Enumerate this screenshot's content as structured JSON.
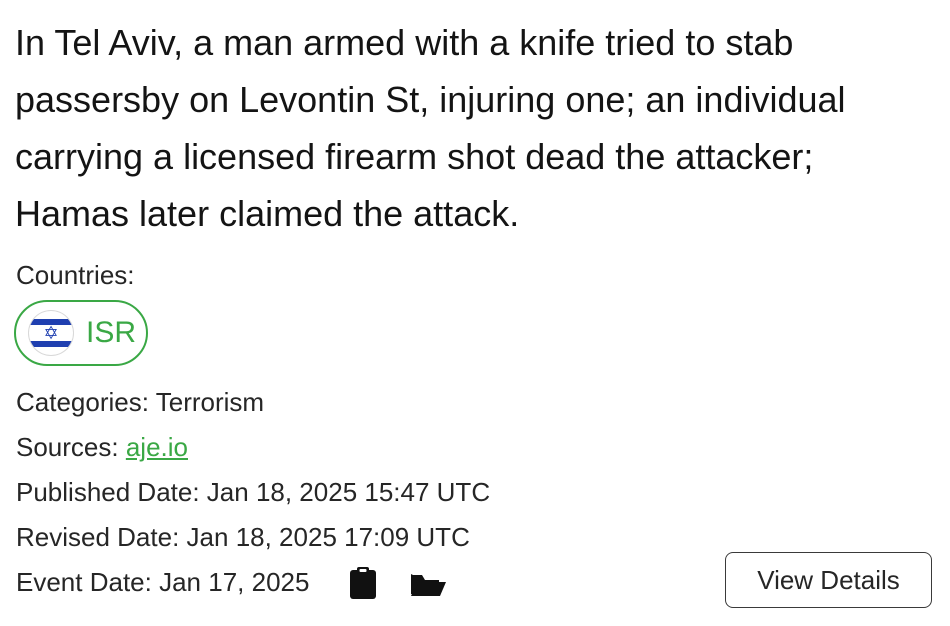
{
  "event": {
    "headline": "In Tel Aviv, a man armed with a knife tried to stab passersby on Levontin St, injuring one; an individual carrying a licensed firearm shot dead the attacker; Hamas later claimed the attack.",
    "countries_label": "Countries:",
    "countries": [
      {
        "code": "ISR",
        "flag_icon": "israel-flag-icon",
        "color": "#3aa845"
      }
    ],
    "categories_label": "Categories:",
    "categories_value": "Terrorism",
    "sources_label": "Sources:",
    "sources_link": "aje.io",
    "published_label": "Published Date:",
    "published_value": "Jan 18, 2025 15:47 UTC",
    "revised_label": "Revised Date:",
    "revised_value": "Jan 18, 2025 17:09 UTC",
    "event_date_label": "Event Date:",
    "event_date_value": "Jan 17, 2025",
    "icons": [
      "clipboard-icon",
      "folder-open-icon"
    ],
    "view_details_label": "View Details"
  },
  "colors": {
    "accent": "#3aa845",
    "flag_blue": "#1f3fb0"
  }
}
